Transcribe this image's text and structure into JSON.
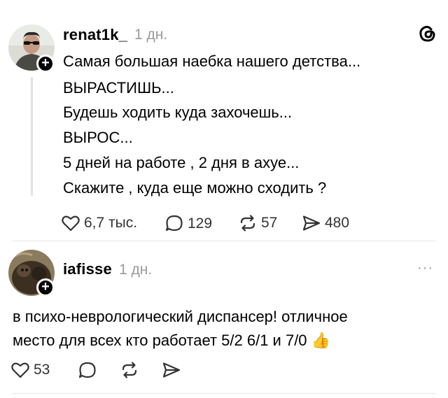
{
  "post1": {
    "username": "renat1k_",
    "time": "1 дн.",
    "lines": [
      "Самая большая наебка нашего детства...",
      "ВЫРАСТИШЬ...",
      "Будешь ходить куда захочешь...",
      "ВЫРОС...",
      "5 дней на работе , 2 дня в ахуе...",
      "Скажите , куда еще можно сходить ?"
    ],
    "likes": "6,7 тыс.",
    "comments": "129",
    "reposts": "57",
    "shares": "480",
    "header_icon": "threads-logo-icon"
  },
  "post2": {
    "username": "iafisse",
    "time": "1 дн.",
    "lines": [
      "в психо-неврологический диспансер! отличное",
      "место для всех кто работает 5/2 6/1 и 7/0"
    ],
    "emoji": "👍",
    "likes": "53",
    "more": "···"
  }
}
